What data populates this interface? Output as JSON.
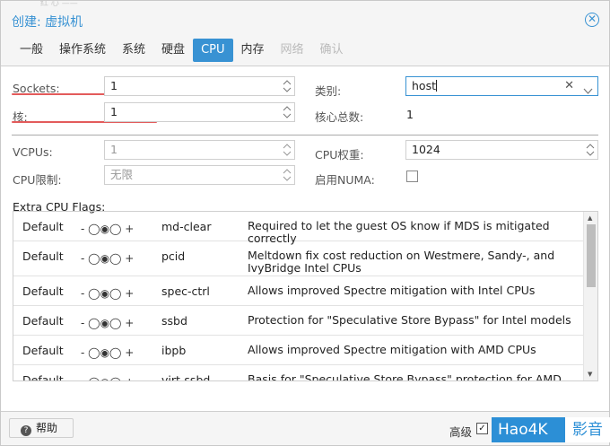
{
  "window": {
    "title": "创建: 虚拟机",
    "background_text": "红 心 ——"
  },
  "tabs": [
    {
      "label": "一般",
      "state": "normal"
    },
    {
      "label": "操作系统",
      "state": "normal"
    },
    {
      "label": "系统",
      "state": "normal"
    },
    {
      "label": "硬盘",
      "state": "normal"
    },
    {
      "label": "CPU",
      "state": "active"
    },
    {
      "label": "内存",
      "state": "normal"
    },
    {
      "label": "网络",
      "state": "disabled"
    },
    {
      "label": "确认",
      "state": "disabled"
    }
  ],
  "form": {
    "sockets": {
      "label": "Sockets:",
      "value": "1"
    },
    "cores": {
      "label": "核:",
      "value": "1"
    },
    "type": {
      "label": "类别:",
      "value": "host",
      "clear_icon": "close-x-icon",
      "dropdown_icon": "chevron-down-icon"
    },
    "total_cores": {
      "label": "核心总数:",
      "value": "1"
    },
    "vcpus": {
      "label": "VCPUs:",
      "value": "1"
    },
    "cpu_weight": {
      "label": "CPU权重:",
      "value": "1024"
    },
    "cpu_limit": {
      "label": "CPU限制:",
      "value": "无限"
    },
    "numa": {
      "label": "启用NUMA:",
      "checked": false
    }
  },
  "flags": {
    "title": "Extra CPU Flags:",
    "rows": [
      {
        "state": "Default",
        "toggle": "- ◯◉◯ +",
        "flag": "md-clear",
        "description": "Required to let the guest OS know if MDS is mitigated correctly"
      },
      {
        "state": "Default",
        "toggle": "- ◯◉◯ +",
        "flag": "pcid",
        "description": "Meltdown fix cost reduction on Westmere, Sandy-, and IvyBridge Intel CPUs"
      },
      {
        "state": "Default",
        "toggle": "- ◯◉◯ +",
        "flag": "spec-ctrl",
        "description": "Allows improved Spectre mitigation with Intel CPUs"
      },
      {
        "state": "Default",
        "toggle": "- ◯◉◯ +",
        "flag": "ssbd",
        "description": "Protection for \"Speculative Store Bypass\" for Intel models"
      },
      {
        "state": "Default",
        "toggle": "- ◯◉◯ +",
        "flag": "ibpb",
        "description": "Allows improved Spectre mitigation with AMD CPUs"
      },
      {
        "state": "Default",
        "toggle": "- ◯◉◯ +",
        "flag": "virt-ssbd",
        "description": "Basis for \"Speculative Store Bypass\" protection for AMD models"
      }
    ]
  },
  "footer": {
    "help_label": "帮助",
    "advanced_label": "高级",
    "advanced_checked": true
  },
  "watermark": {
    "text": "Hao4K",
    "text2": "影音"
  },
  "colors": {
    "accent": "#3892d3",
    "underline": "#e35b5b"
  }
}
